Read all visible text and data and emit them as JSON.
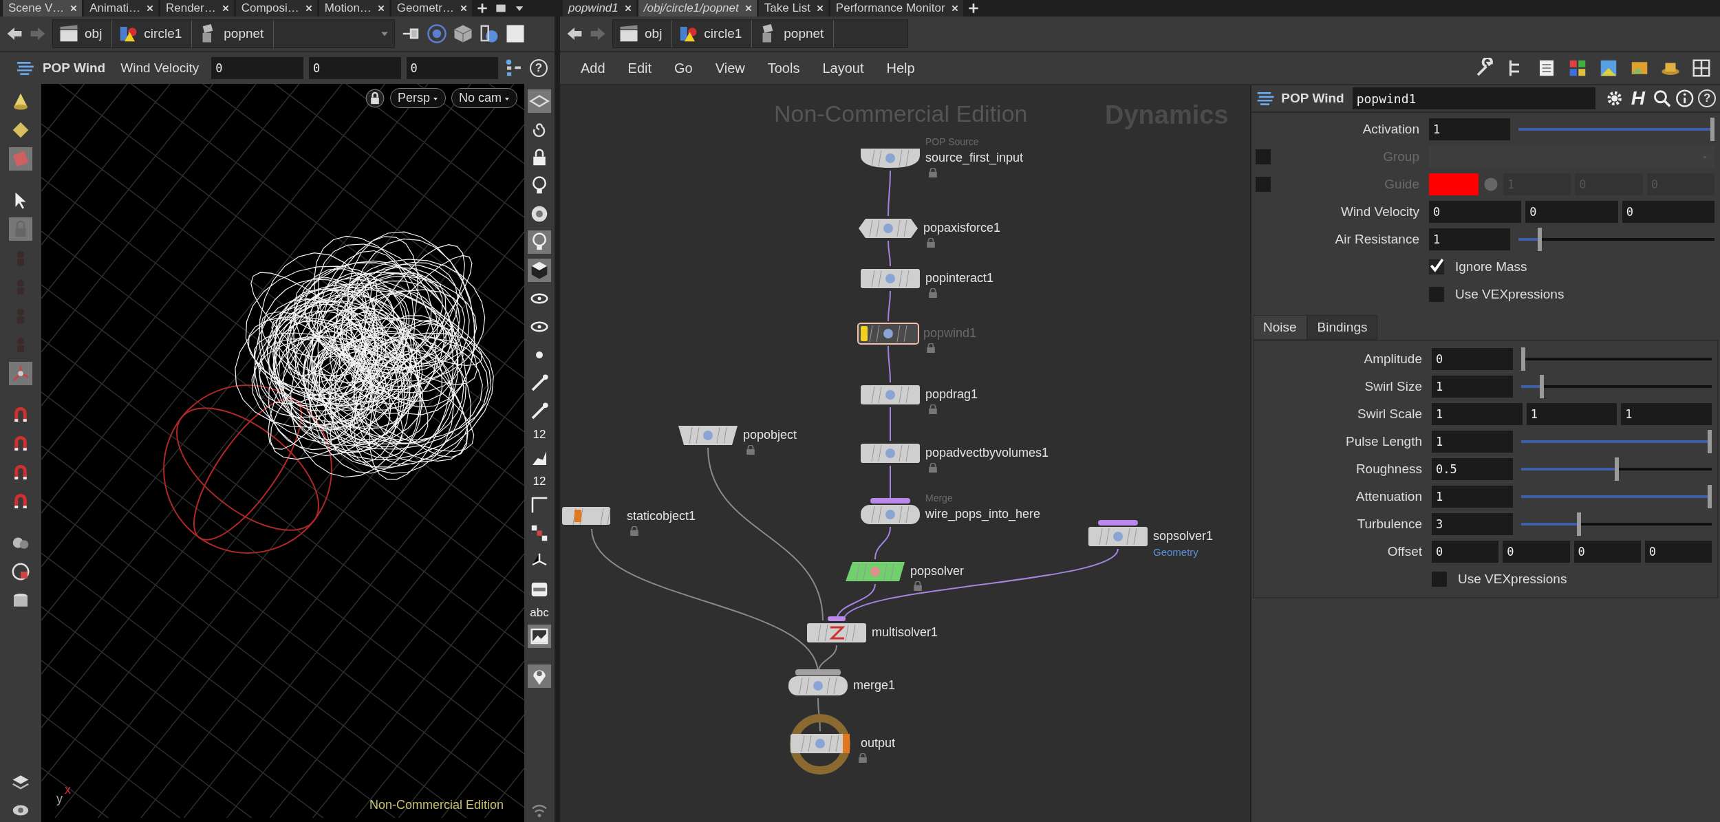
{
  "left_pane": {
    "tabs": [
      {
        "label": "Scene V…",
        "selected": true
      },
      {
        "label": "Animati…",
        "selected": false
      },
      {
        "label": "Render…",
        "selected": false
      },
      {
        "label": "Composi…",
        "selected": false
      },
      {
        "label": "Motion…",
        "selected": false
      },
      {
        "label": "Geometr…",
        "selected": false
      }
    ],
    "path": [
      "obj",
      "circle1",
      "popnet"
    ],
    "operator_bar": {
      "node_type": "POP Wind",
      "parameter": "Wind Velocity",
      "values": [
        "0",
        "0",
        "0"
      ],
      "help_button": "?"
    },
    "viewport": {
      "camera_buttons": [
        "Persp",
        "No cam"
      ],
      "edition_label": "Non-Commercial Edition",
      "axis_labels": [
        "y",
        "x"
      ],
      "tool_labels": [
        "12",
        "12",
        "abc"
      ]
    }
  },
  "network_pane": {
    "tabs": [
      {
        "label": "popwind1",
        "selected": false,
        "pinned": true
      },
      {
        "label": "/obj/circle1/popnet",
        "selected": true,
        "pinned": true
      },
      {
        "label": "Take List",
        "selected": false,
        "pinned": false
      },
      {
        "label": "Performance Monitor",
        "selected": false,
        "pinned": false
      }
    ],
    "path": [
      "obj",
      "circle1",
      "popnet"
    ],
    "menu": [
      "Add",
      "Edit",
      "Go",
      "View",
      "Tools",
      "Layout",
      "Help"
    ],
    "graph": {
      "edition_label": "Non-Commercial Edition",
      "context_label": "Dynamics",
      "nodes": [
        {
          "name": "source_first_input",
          "type_label": "POP Source",
          "kind": "source",
          "bypassed": false,
          "selected": false,
          "lock_icon": true
        },
        {
          "name": "popaxisforce1",
          "kind": "force",
          "bypassed": false,
          "selected": false,
          "lock_icon": true
        },
        {
          "name": "popinteract1",
          "kind": "pop",
          "bypassed": false,
          "selected": false,
          "lock_icon": true
        },
        {
          "name": "popwind1",
          "kind": "pop",
          "bypassed": true,
          "selected": true,
          "lock_icon": true
        },
        {
          "name": "popdrag1",
          "kind": "pop",
          "bypassed": false,
          "selected": false,
          "lock_icon": true
        },
        {
          "name": "popobject",
          "kind": "object",
          "bypassed": false,
          "selected": false,
          "lock_icon": true
        },
        {
          "name": "popadvectbyvolumes1",
          "kind": "pop",
          "bypassed": false,
          "selected": false,
          "lock_icon": true
        },
        {
          "name": "staticobject1",
          "kind": "static",
          "bypassed": false,
          "selected": false,
          "lock_icon": true
        },
        {
          "name": "wire_pops_into_here",
          "type_label": "Merge",
          "kind": "pop_merge",
          "bypassed": false,
          "selected": false,
          "lock_icon": false
        },
        {
          "name": "sopsolver1",
          "context_label": "Geometry",
          "kind": "sop_solver",
          "bypassed": false,
          "selected": false,
          "lock_icon": false
        },
        {
          "name": "popsolver",
          "kind": "solver",
          "bypassed": false,
          "selected": false,
          "lock_icon": true
        },
        {
          "name": "multisolver1",
          "kind": "multisolver",
          "bypassed": false,
          "selected": false,
          "lock_icon": false
        },
        {
          "name": "merge1",
          "kind": "merge",
          "bypassed": false,
          "selected": false,
          "lock_icon": false
        },
        {
          "name": "output",
          "kind": "output",
          "bypassed": false,
          "selected": false,
          "lock_icon": true
        }
      ]
    }
  },
  "parameters": {
    "node_type": "POP Wind",
    "node_name": "popwind1",
    "hda_button": "H",
    "help_button": "?",
    "rows": [
      {
        "kind": "slider",
        "label": "Activation",
        "value": "1",
        "level": 1.0
      },
      {
        "kind": "menu",
        "label": "Group",
        "disabled": true,
        "toggle_checked": false
      },
      {
        "kind": "color",
        "label": "Guide",
        "disabled": true,
        "toggle_checked": false,
        "color": "#ff0000",
        "values": [
          "1",
          "0",
          "0"
        ]
      },
      {
        "kind": "vector",
        "label": "Wind Velocity",
        "values": [
          "0",
          "0",
          "0"
        ]
      },
      {
        "kind": "slider",
        "label": "Air Resistance",
        "value": "1",
        "level": 0.1
      },
      {
        "kind": "checkbox",
        "label": "Ignore Mass",
        "checked": true
      },
      {
        "kind": "checkbox",
        "label": "Use VEXpressions",
        "checked": false
      }
    ],
    "tabs": [
      {
        "label": "Noise",
        "selected": true
      },
      {
        "label": "Bindings",
        "selected": false
      }
    ],
    "noise_rows": [
      {
        "kind": "slider",
        "label": "Amplitude",
        "value": "0",
        "level": 0.0
      },
      {
        "kind": "slider",
        "label": "Swirl Size",
        "value": "1",
        "level": 0.1
      },
      {
        "kind": "vector",
        "label": "Swirl Scale",
        "values": [
          "1",
          "1",
          "1"
        ]
      },
      {
        "kind": "slider",
        "label": "Pulse Length",
        "value": "1",
        "level": 1.0
      },
      {
        "kind": "slider",
        "label": "Roughness",
        "value": "0.5",
        "level": 0.5
      },
      {
        "kind": "slider",
        "label": "Attenuation",
        "value": "1",
        "level": 1.0
      },
      {
        "kind": "slider",
        "label": "Turbulence",
        "value": "3",
        "level": 0.3
      },
      {
        "kind": "vector",
        "label": "Offset",
        "values": [
          "0",
          "0",
          "0",
          "0"
        ]
      },
      {
        "kind": "checkbox",
        "label": "Use VEXpressions",
        "checked": false
      }
    ]
  }
}
